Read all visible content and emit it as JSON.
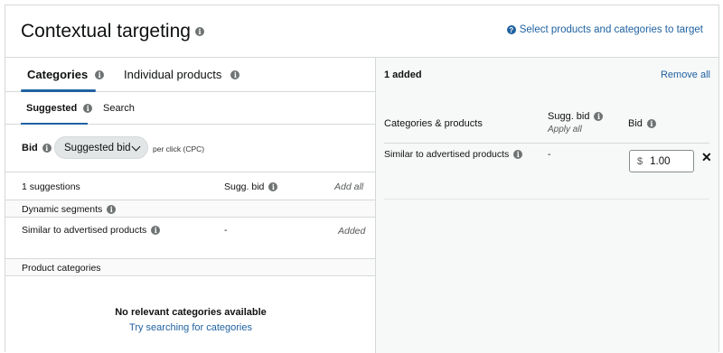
{
  "header": {
    "title": "Contextual targeting",
    "help_link": "Select products and categories to target"
  },
  "left": {
    "tabs": [
      {
        "label": "Categories",
        "active": true
      },
      {
        "label": "Individual products",
        "active": false
      }
    ],
    "subtabs": [
      {
        "label": "Suggested",
        "active": true
      },
      {
        "label": "Search",
        "active": false
      }
    ],
    "bid": {
      "label": "Bid",
      "select_value": "Suggested bid",
      "per_click": "per click (CPC)"
    },
    "table": {
      "count_label": "1 suggestions",
      "sugg_bid_header": "Sugg. bid",
      "add_all": "Add all",
      "sections": [
        {
          "title": "Dynamic segments"
        },
        {
          "title": "Product categories"
        }
      ],
      "rows": [
        {
          "name": "Similar to advertised products",
          "sugg_bid": "-",
          "action": "Added"
        }
      ]
    },
    "empty": {
      "title": "No relevant categories available",
      "link": "Try searching for categories"
    }
  },
  "right": {
    "count_label": "1 added",
    "remove_all": "Remove all",
    "columns": {
      "name": "Categories & products",
      "sugg_bid": "Sugg. bid",
      "apply_all": "Apply all",
      "bid": "Bid"
    },
    "rows": [
      {
        "name": "Similar to advertised products",
        "sugg_bid": "-",
        "currency": "$",
        "bid": "1.00",
        "remove": "✕"
      }
    ]
  },
  "colors": {
    "link": "#2162a1",
    "border": "#d5d9d9",
    "panel_bg": "#f7f8f8"
  },
  "icons": {
    "info": "info-icon",
    "help": "question-circle-icon",
    "chevron": "chevron-down-icon",
    "close": "close-icon"
  }
}
